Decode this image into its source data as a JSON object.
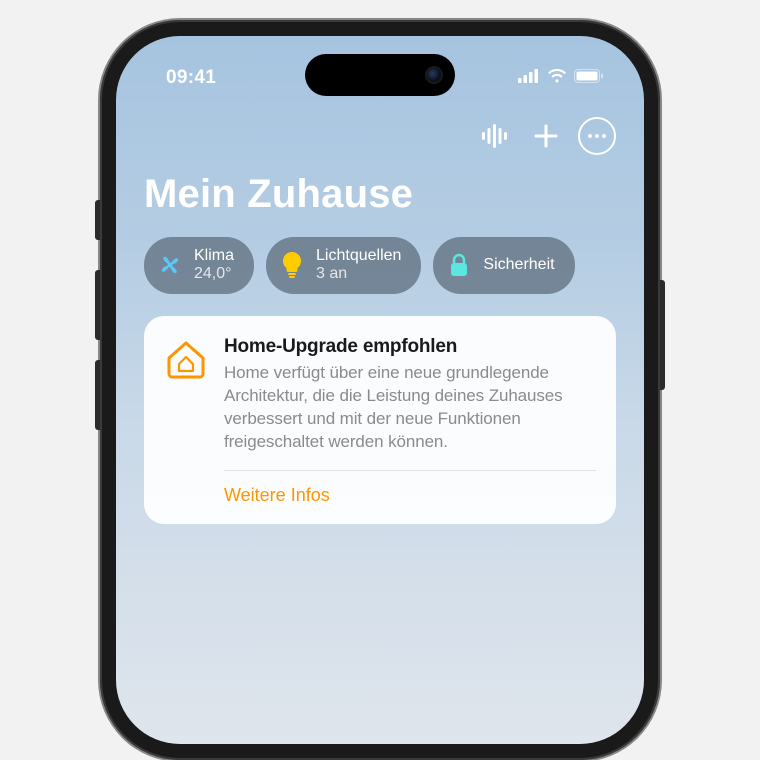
{
  "statusbar": {
    "time": "09:41"
  },
  "header": {
    "title": "Mein Zuhause"
  },
  "chips": [
    {
      "icon": "fan",
      "label": "Klima",
      "value": "24,0°",
      "icon_color": "#5ac8fa"
    },
    {
      "icon": "lightbulb",
      "label": "Lichtquellen",
      "value": "3 an",
      "icon_color": "#ffcc00"
    },
    {
      "icon": "lock",
      "label": "Sicherheit",
      "value": "",
      "icon_color": "#5ce6e0"
    }
  ],
  "card": {
    "title": "Home-Upgrade empfohlen",
    "description": "Home verfügt über eine neue grundlegende Architektur, die die Leistung deines Zuhauses verbessert und mit der neue Funktionen freigeschaltet werden können.",
    "link_label": "Weitere Infos",
    "accent_color": "#ff9500"
  }
}
